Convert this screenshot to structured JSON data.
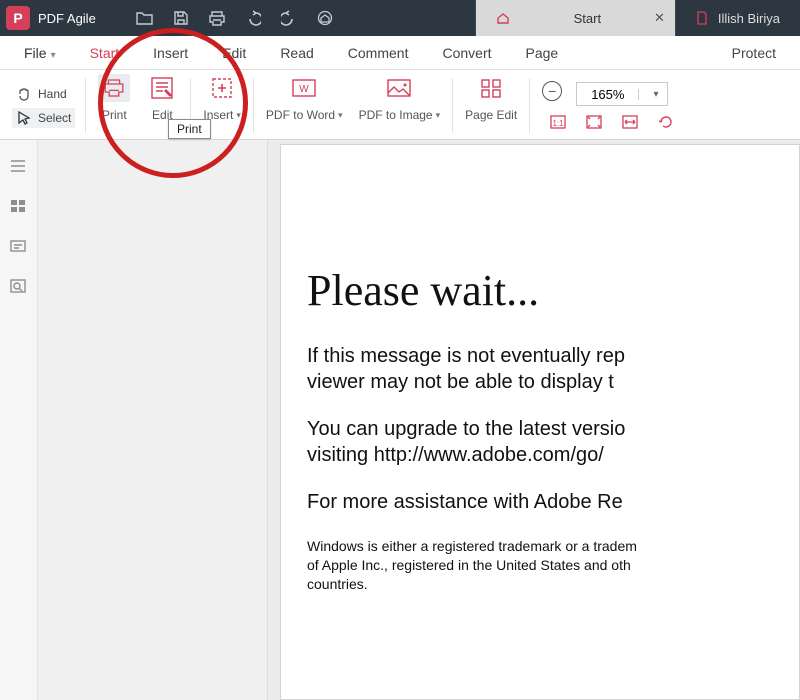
{
  "app": {
    "name": "PDF Agile"
  },
  "tabs": {
    "active": {
      "label": "Start"
    },
    "inactive": {
      "label": "Illish Biriya"
    }
  },
  "menu": {
    "file": "File",
    "start": "Start",
    "insert": "Insert",
    "edit": "Edit",
    "read": "Read",
    "comment": "Comment",
    "convert": "Convert",
    "page": "Page",
    "protect": "Protect"
  },
  "ribbon": {
    "hand": "Hand",
    "select": "Select",
    "print": "Print",
    "edit": "Edit",
    "insert": "Insert",
    "pdf_to_word": "PDF to Word",
    "pdf_to_image": "PDF to Image",
    "page_edit": "Page Edit",
    "zoom": "165%"
  },
  "tooltip": {
    "print": "Print"
  },
  "doc": {
    "heading": "Please wait...",
    "p1": "If this message is not eventually rep",
    "p2": "viewer may not be able to display t",
    "p3": "You can upgrade to the latest versio",
    "p4": "visiting  http://www.adobe.com/go/",
    "p5": "For more assistance with Adobe Re",
    "fine1": "Windows is either a registered trademark or a tradem",
    "fine2": "of Apple Inc., registered in the United States and oth",
    "fine3": "countries."
  }
}
